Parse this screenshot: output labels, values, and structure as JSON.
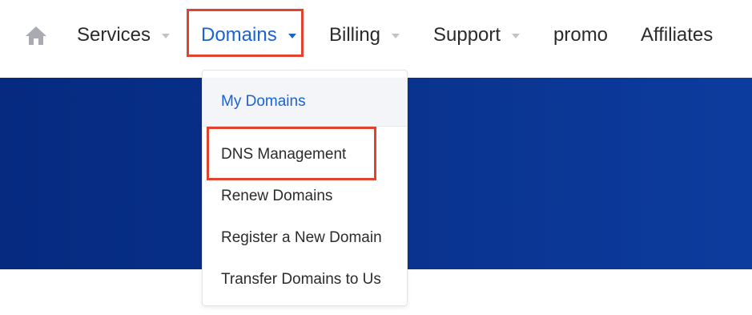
{
  "nav": {
    "home_icon": "home-icon",
    "items": [
      {
        "label": "Services",
        "has_caret": true
      },
      {
        "label": "Domains",
        "has_caret": true,
        "active": true
      },
      {
        "label": "Billing",
        "has_caret": true
      },
      {
        "label": "Support",
        "has_caret": true
      },
      {
        "label": "promo",
        "has_caret": false
      },
      {
        "label": "Affiliates",
        "has_caret": false
      }
    ]
  },
  "dropdown": {
    "items": [
      {
        "label": "My Domains",
        "current": true
      },
      {
        "label": "DNS Management",
        "highlighted": true
      },
      {
        "label": "Renew Domains"
      },
      {
        "label": "Register a New Domain"
      },
      {
        "label": "Transfer Domains to Us"
      }
    ]
  },
  "colors": {
    "accent": "#1a62d6",
    "hero_blue": "#0a338f",
    "highlight_red": "#e0432f"
  }
}
